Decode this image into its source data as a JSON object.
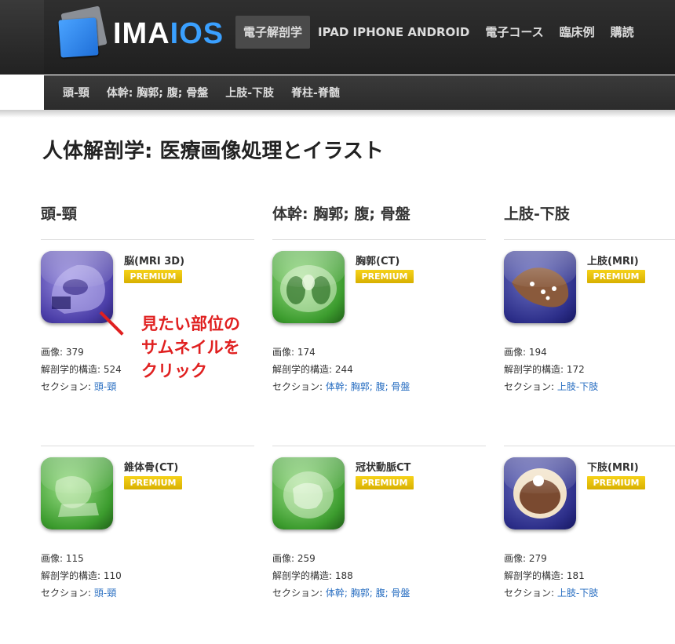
{
  "logo": {
    "text_a": "IMA",
    "text_b": "IOS"
  },
  "main_nav": [
    {
      "label": "電子解剖学",
      "active": true
    },
    {
      "label": "IPAD IPHONE ANDROID",
      "active": false
    },
    {
      "label": "電子コース",
      "active": false
    },
    {
      "label": "臨床例",
      "active": false
    },
    {
      "label": "購読",
      "active": false
    }
  ],
  "sub_nav": [
    "頭-頸",
    "体幹: 胸郭; 腹; 骨盤",
    "上肢-下肢",
    "脊柱-脊髄"
  ],
  "page_title": "人体解剖学: 医療画像処理とイラスト",
  "columns": [
    "頭-頸",
    "体幹: 胸郭; 腹; 骨盤",
    "上肢-下肢"
  ],
  "badge_label": "PREMIUM",
  "meta_labels": {
    "images": "画像: ",
    "structures": "解剖学的構造: ",
    "section": "セクション: "
  },
  "cards": [
    {
      "title": "脳(MRI 3D)",
      "images": "379",
      "structures": "524",
      "section": "頭-頸",
      "color": "blue"
    },
    {
      "title": "胸郭(CT)",
      "images": "174",
      "structures": "244",
      "section": "体幹; 胸郭; 腹; 骨盤",
      "color": "green"
    },
    {
      "title": "上肢(MRI)",
      "images": "194",
      "structures": "172",
      "section": "上肢-下肢",
      "color": "navy"
    },
    {
      "title": "錐体骨(CT)",
      "images": "115",
      "structures": "110",
      "section": "頭-頸",
      "color": "green"
    },
    {
      "title": "冠状動脈CT",
      "images": "259",
      "structures": "188",
      "section": "体幹; 胸郭; 腹; 骨盤",
      "color": "green"
    },
    {
      "title": "下肢(MRI)",
      "images": "279",
      "structures": "181",
      "section": "上肢-下肢",
      "color": "navy"
    }
  ],
  "annotation": {
    "line1": "見たい部位の",
    "line2": "サムネイルを",
    "line3": "クリック"
  },
  "accent_colors": {
    "link": "#2a6fc2",
    "badge": "#e6c000",
    "annotation": "#e02020",
    "logo_accent": "#3aa0ff"
  }
}
